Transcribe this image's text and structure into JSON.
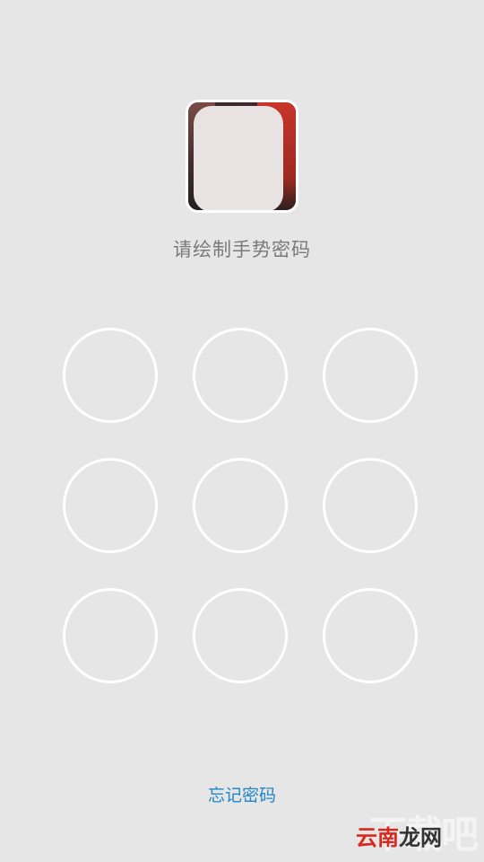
{
  "prompt_text": "请绘制手势密码",
  "forgot_label": "忘记密码",
  "pattern_nodes": 9,
  "watermark": {
    "part1": "云南",
    "part2": "龙网",
    "bg": "下载吧"
  },
  "colors": {
    "background": "#e6e6e6",
    "node_stroke": "#ffffff",
    "prompt": "#7a7a7a",
    "link": "#1f86c8"
  }
}
